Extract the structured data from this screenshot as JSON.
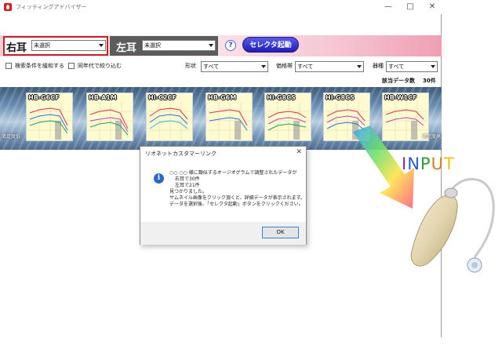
{
  "window": {
    "title": "フィッティングアドバイザー",
    "controls": [
      "—",
      "□",
      "✕"
    ]
  },
  "ear_selector": {
    "right_label": "右耳",
    "right_value": "未選択",
    "left_label": "左耳",
    "left_value": "未選択",
    "help_label": "?",
    "selector_button": "セレクタ起動"
  },
  "filters": {
    "relax_label": "検索条件を緩和する",
    "age_label": "同年代で絞り込む",
    "shape_label": "形状",
    "shape_value": "すべて",
    "price_label": "価格帯",
    "price_value": "すべて",
    "model_label": "器種",
    "model_value": "すべて"
  },
  "results": {
    "count_label": "該当データ数",
    "count_value": "30件"
  },
  "strip": {
    "left_note": "満足度低",
    "right_note": "満足度高",
    "thumbnails": [
      {
        "label": "HB-G6CF"
      },
      {
        "label": "HB-A1M"
      },
      {
        "label": "HI-C2CF"
      },
      {
        "label": "HB-G6M"
      },
      {
        "label": "HI-G8CS"
      },
      {
        "label": "HI-G8CS"
      },
      {
        "label": "HB-W1CF"
      }
    ]
  },
  "dialog": {
    "title": "リオネットカスタマーリンク",
    "close": "✕",
    "lines": [
      "○○ ○○ 様に類似するオージオグラムで調整されたデータが",
      "右耳で30件",
      "左耳で21件",
      "見つかりました。",
      "サムネイル画像をクリック頂くと、詳細データが表示されます。",
      "データを選択後、「セレクタ起動」ボタンをクリックください。"
    ],
    "ok_label": "OK"
  },
  "overlay": {
    "input_word": "INPUT",
    "letter_colors": [
      "#7a2fb5",
      "#2a57d6",
      "#2a9d3c",
      "#e07a1c",
      "#e8c21c"
    ]
  }
}
